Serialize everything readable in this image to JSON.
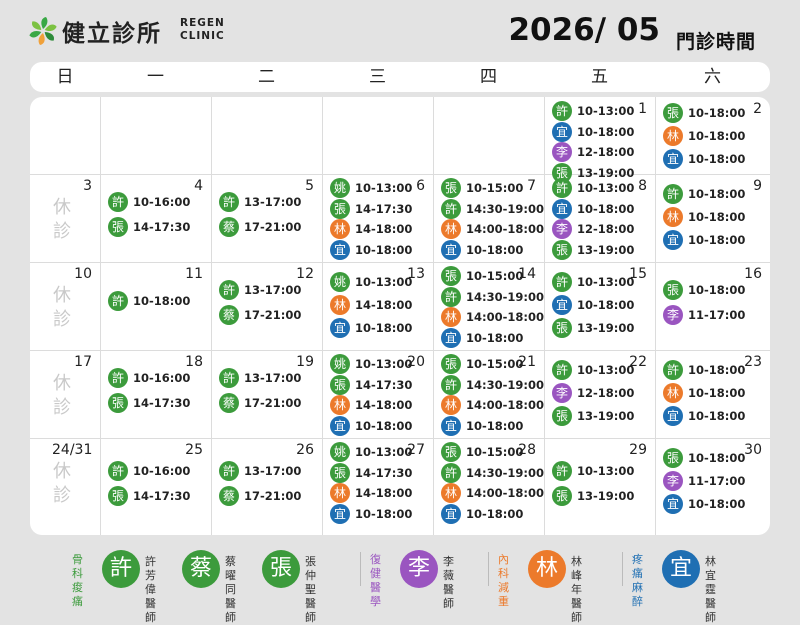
{
  "header": {
    "clinic_name": "健立診所",
    "clinic_eng_1": "REGEN",
    "clinic_eng_2": "CLINIC",
    "year_month": "2026/ 05",
    "schedule_title": "門診時間"
  },
  "weekdays": [
    "日",
    "一",
    "二",
    "三",
    "四",
    "五",
    "六"
  ],
  "rest_label": "休診",
  "colors": {
    "green": "#3c9b3c",
    "orange": "#ec7a2b",
    "purple": "#9a55c0",
    "blue": "#1f6fb3"
  },
  "weeks": [
    [
      {
        "day": "",
        "rest": false,
        "entries": []
      },
      {
        "day": "",
        "rest": false,
        "entries": []
      },
      {
        "day": "",
        "rest": false,
        "entries": []
      },
      {
        "day": "",
        "rest": false,
        "entries": []
      },
      {
        "day": "",
        "rest": false,
        "entries": []
      },
      {
        "day": "1",
        "rest": false,
        "entries": [
          {
            "d": "許",
            "c": "green",
            "t": "10-13:00"
          },
          {
            "d": "宜",
            "c": "blue",
            "t": "10-18:00"
          },
          {
            "d": "李",
            "c": "purple",
            "t": "12-18:00"
          },
          {
            "d": "張",
            "c": "green",
            "t": "13-19:00"
          }
        ]
      },
      {
        "day": "2",
        "rest": false,
        "entries": [
          {
            "d": "張",
            "c": "green",
            "t": "10-18:00"
          },
          {
            "d": "林",
            "c": "orange",
            "t": "10-18:00"
          },
          {
            "d": "宜",
            "c": "blue",
            "t": "10-18:00"
          }
        ]
      }
    ],
    [
      {
        "day": "3",
        "rest": true,
        "entries": []
      },
      {
        "day": "4",
        "rest": false,
        "entries": [
          {
            "d": "許",
            "c": "green",
            "t": "10-16:00"
          },
          {
            "d": "張",
            "c": "green",
            "t": "14-17:30"
          }
        ]
      },
      {
        "day": "5",
        "rest": false,
        "entries": [
          {
            "d": "許",
            "c": "green",
            "t": "13-17:00"
          },
          {
            "d": "蔡",
            "c": "green",
            "t": "17-21:00"
          }
        ]
      },
      {
        "day": "6",
        "rest": false,
        "entries": [
          {
            "d": "姚",
            "c": "green",
            "t": "10-13:00"
          },
          {
            "d": "張",
            "c": "green",
            "t": "14-17:30"
          },
          {
            "d": "林",
            "c": "orange",
            "t": "14-18:00"
          },
          {
            "d": "宜",
            "c": "blue",
            "t": "10-18:00"
          }
        ]
      },
      {
        "day": "7",
        "rest": false,
        "entries": [
          {
            "d": "張",
            "c": "green",
            "t": "10-15:00"
          },
          {
            "d": "許",
            "c": "green",
            "t": "14:30-19:00"
          },
          {
            "d": "林",
            "c": "orange",
            "t": "14:00-18:00"
          },
          {
            "d": "宜",
            "c": "blue",
            "t": "10-18:00"
          }
        ]
      },
      {
        "day": "8",
        "rest": false,
        "entries": [
          {
            "d": "許",
            "c": "green",
            "t": "10-13:00"
          },
          {
            "d": "宜",
            "c": "blue",
            "t": "10-18:00"
          },
          {
            "d": "李",
            "c": "purple",
            "t": "12-18:00"
          },
          {
            "d": "張",
            "c": "green",
            "t": "13-19:00"
          }
        ]
      },
      {
        "day": "9",
        "rest": false,
        "entries": [
          {
            "d": "許",
            "c": "green",
            "t": "10-18:00"
          },
          {
            "d": "林",
            "c": "orange",
            "t": "10-18:00"
          },
          {
            "d": "宜",
            "c": "blue",
            "t": "10-18:00"
          }
        ]
      }
    ],
    [
      {
        "day": "10",
        "rest": true,
        "entries": []
      },
      {
        "day": "11",
        "rest": false,
        "entries": [
          {
            "d": "許",
            "c": "green",
            "t": "10-18:00"
          }
        ]
      },
      {
        "day": "12",
        "rest": false,
        "entries": [
          {
            "d": "許",
            "c": "green",
            "t": "13-17:00"
          },
          {
            "d": "蔡",
            "c": "green",
            "t": "17-21:00"
          }
        ]
      },
      {
        "day": "13",
        "rest": false,
        "entries": [
          {
            "d": "姚",
            "c": "green",
            "t": "10-13:00"
          },
          {
            "d": "林",
            "c": "orange",
            "t": "14-18:00"
          },
          {
            "d": "宜",
            "c": "blue",
            "t": "10-18:00"
          }
        ]
      },
      {
        "day": "14",
        "rest": false,
        "entries": [
          {
            "d": "張",
            "c": "green",
            "t": "10-15:00"
          },
          {
            "d": "許",
            "c": "green",
            "t": "14:30-19:00"
          },
          {
            "d": "林",
            "c": "orange",
            "t": "14:00-18:00"
          },
          {
            "d": "宜",
            "c": "blue",
            "t": "10-18:00"
          }
        ]
      },
      {
        "day": "15",
        "rest": false,
        "entries": [
          {
            "d": "許",
            "c": "green",
            "t": "10-13:00"
          },
          {
            "d": "宜",
            "c": "blue",
            "t": "10-18:00"
          },
          {
            "d": "張",
            "c": "green",
            "t": "13-19:00"
          }
        ]
      },
      {
        "day": "16",
        "rest": false,
        "entries": [
          {
            "d": "張",
            "c": "green",
            "t": "10-18:00"
          },
          {
            "d": "李",
            "c": "purple",
            "t": "11-17:00"
          }
        ]
      }
    ],
    [
      {
        "day": "17",
        "rest": true,
        "entries": []
      },
      {
        "day": "18",
        "rest": false,
        "entries": [
          {
            "d": "許",
            "c": "green",
            "t": "10-16:00"
          },
          {
            "d": "張",
            "c": "green",
            "t": "14-17:30"
          }
        ]
      },
      {
        "day": "19",
        "rest": false,
        "entries": [
          {
            "d": "許",
            "c": "green",
            "t": "13-17:00"
          },
          {
            "d": "蔡",
            "c": "green",
            "t": "17-21:00"
          }
        ]
      },
      {
        "day": "20",
        "rest": false,
        "entries": [
          {
            "d": "姚",
            "c": "green",
            "t": "10-13:00"
          },
          {
            "d": "張",
            "c": "green",
            "t": "14-17:30"
          },
          {
            "d": "林",
            "c": "orange",
            "t": "14-18:00"
          },
          {
            "d": "宜",
            "c": "blue",
            "t": "10-18:00"
          }
        ]
      },
      {
        "day": "21",
        "rest": false,
        "entries": [
          {
            "d": "張",
            "c": "green",
            "t": "10-15:00"
          },
          {
            "d": "許",
            "c": "green",
            "t": "14:30-19:00"
          },
          {
            "d": "林",
            "c": "orange",
            "t": "14:00-18:00"
          },
          {
            "d": "宜",
            "c": "blue",
            "t": "10-18:00"
          }
        ]
      },
      {
        "day": "22",
        "rest": false,
        "entries": [
          {
            "d": "許",
            "c": "green",
            "t": "10-13:00"
          },
          {
            "d": "李",
            "c": "purple",
            "t": "12-18:00"
          },
          {
            "d": "張",
            "c": "green",
            "t": "13-19:00"
          }
        ]
      },
      {
        "day": "23",
        "rest": false,
        "entries": [
          {
            "d": "許",
            "c": "green",
            "t": "10-18:00"
          },
          {
            "d": "林",
            "c": "orange",
            "t": "10-18:00"
          },
          {
            "d": "宜",
            "c": "blue",
            "t": "10-18:00"
          }
        ]
      }
    ],
    [
      {
        "day": "24/31",
        "rest": true,
        "entries": []
      },
      {
        "day": "25",
        "rest": false,
        "entries": [
          {
            "d": "許",
            "c": "green",
            "t": "10-16:00"
          },
          {
            "d": "張",
            "c": "green",
            "t": "14-17:30"
          }
        ]
      },
      {
        "day": "26",
        "rest": false,
        "entries": [
          {
            "d": "許",
            "c": "green",
            "t": "13-17:00"
          },
          {
            "d": "蔡",
            "c": "green",
            "t": "17-21:00"
          }
        ]
      },
      {
        "day": "27",
        "rest": false,
        "entries": [
          {
            "d": "姚",
            "c": "green",
            "t": "10-13:00"
          },
          {
            "d": "張",
            "c": "green",
            "t": "14-17:30"
          },
          {
            "d": "林",
            "c": "orange",
            "t": "14-18:00"
          },
          {
            "d": "宜",
            "c": "blue",
            "t": "10-18:00"
          }
        ]
      },
      {
        "day": "28",
        "rest": false,
        "entries": [
          {
            "d": "張",
            "c": "green",
            "t": "10-15:00"
          },
          {
            "d": "許",
            "c": "green",
            "t": "14:30-19:00"
          },
          {
            "d": "林",
            "c": "orange",
            "t": "14:00-18:00"
          },
          {
            "d": "宜",
            "c": "blue",
            "t": "10-18:00"
          }
        ]
      },
      {
        "day": "29",
        "rest": false,
        "entries": [
          {
            "d": "許",
            "c": "green",
            "t": "10-13:00"
          },
          {
            "d": "張",
            "c": "green",
            "t": "13-19:00"
          }
        ]
      },
      {
        "day": "30",
        "rest": false,
        "entries": [
          {
            "d": "張",
            "c": "green",
            "t": "10-18:00"
          },
          {
            "d": "李",
            "c": "purple",
            "t": "11-17:00"
          },
          {
            "d": "宜",
            "c": "blue",
            "t": "10-18:00"
          }
        ]
      }
    ]
  ],
  "legend": [
    {
      "specialty": [
        "骨科",
        "痠痛"
      ],
      "c": "green",
      "doctors": [
        {
          "d": "許",
          "name": "許芳偉",
          "title": "醫師"
        },
        {
          "d": "蔡",
          "name": "蔡曜同",
          "title": "醫師"
        },
        {
          "d": "張",
          "name": "張仲聖",
          "title": "醫師"
        }
      ]
    },
    {
      "specialty": [
        "復健",
        "醫學"
      ],
      "c": "purple",
      "doctors": [
        {
          "d": "李",
          "name": "李薇",
          "title": "醫師"
        }
      ]
    },
    {
      "specialty": [
        "內科",
        "減重"
      ],
      "c": "orange",
      "doctors": [
        {
          "d": "林",
          "name": "林峰年",
          "title": "醫師"
        }
      ]
    },
    {
      "specialty": [
        "疼痛",
        "麻醉"
      ],
      "c": "blue",
      "doctors": [
        {
          "d": "宜",
          "name": "林宜霆",
          "title": "醫師"
        }
      ]
    }
  ]
}
